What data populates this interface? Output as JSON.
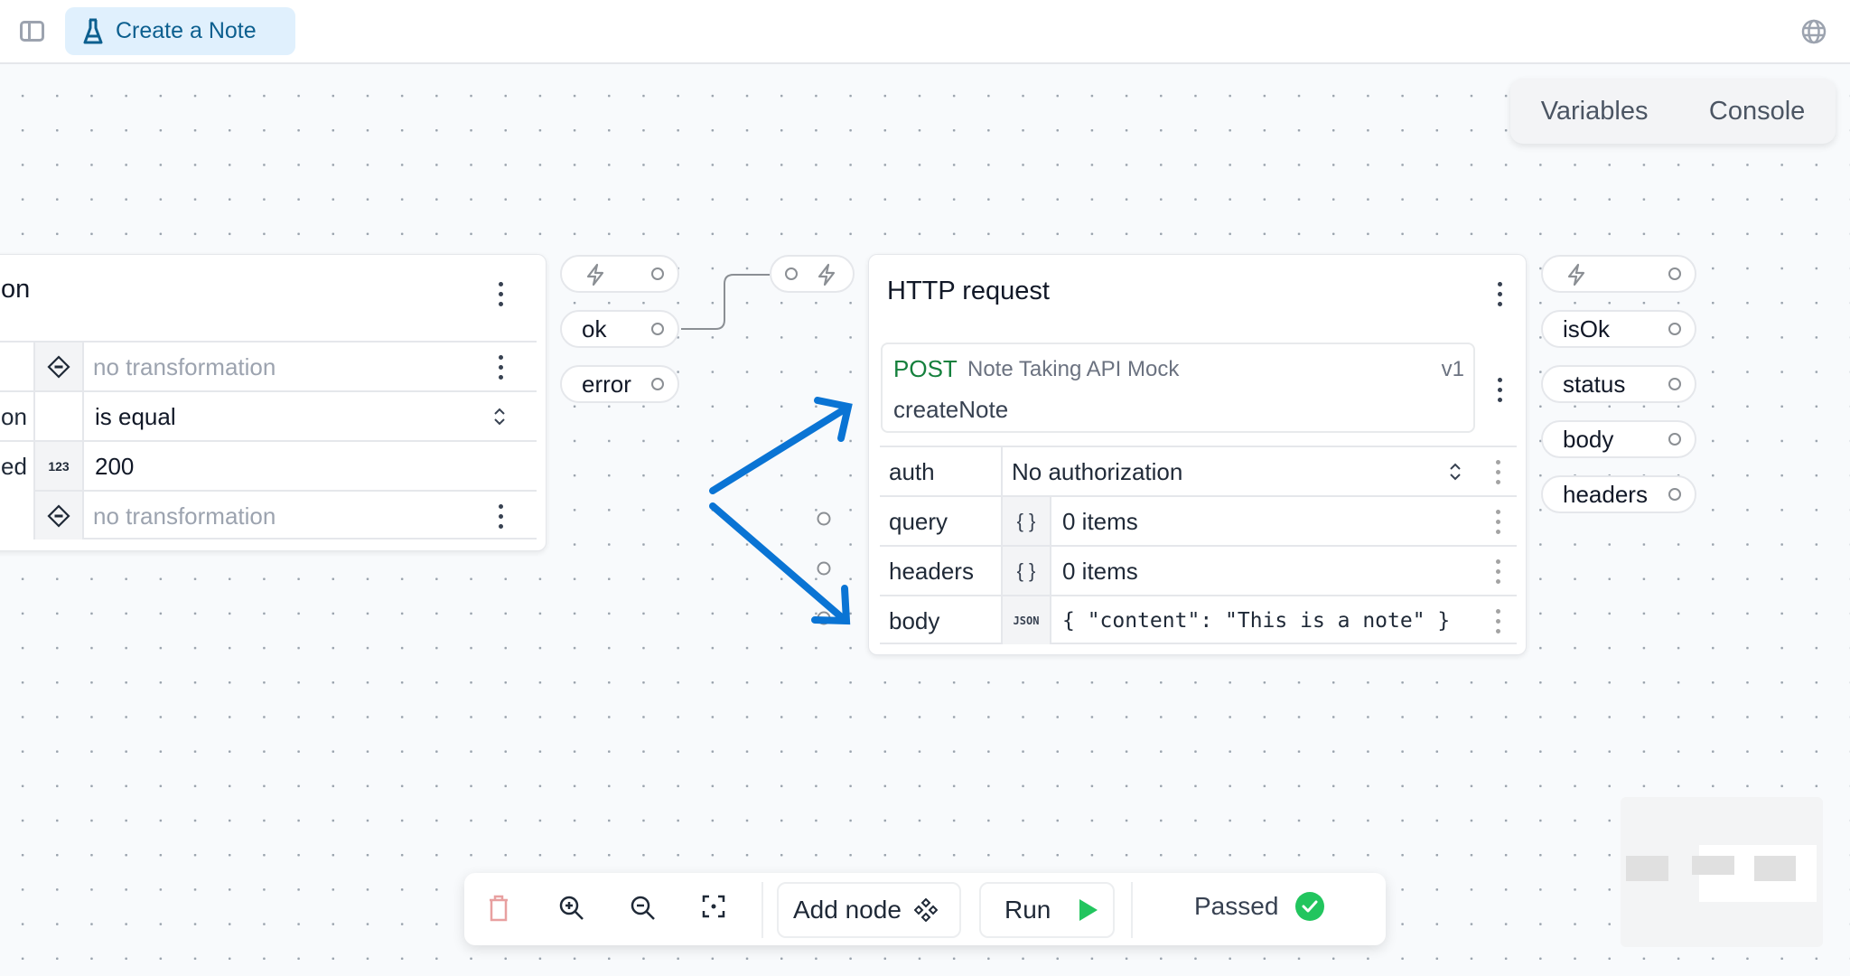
{
  "header": {
    "tab_title": "Create a Note",
    "tab_icon": "flask-icon",
    "sidebar_toggle_icon": "sidebar-icon",
    "language_icon": "globe-icon"
  },
  "panel_tabs": [
    "Variables",
    "Console"
  ],
  "left_node": {
    "title_fragment": "on",
    "rows": [
      {
        "label": "",
        "icon": "transform-icon",
        "value": "no transformation",
        "muted": true
      },
      {
        "label": "on",
        "icon": "",
        "value": "is equal",
        "muted": false
      },
      {
        "label": "ed",
        "icon": "number-icon",
        "icon_text": "123",
        "value": "200",
        "muted": false
      },
      {
        "label": "",
        "icon": "transform-icon",
        "value": "no transformation",
        "muted": true
      }
    ],
    "outputs": [
      "trigger",
      "ok",
      "error"
    ]
  },
  "http_node": {
    "title": "HTTP request",
    "operation": {
      "method": "POST",
      "api": "Note Taking API Mock",
      "version": "v1",
      "name": "createNote"
    },
    "params": [
      {
        "label": "auth",
        "value": "No authorization",
        "type": "select"
      },
      {
        "label": "query",
        "icon_text": "{ }",
        "value": "0 items"
      },
      {
        "label": "headers",
        "icon_text": "{ }",
        "value": "0 items"
      },
      {
        "label": "body",
        "icon_text": "JSON",
        "value": "{ \"content\": \"This is a note\" }"
      }
    ],
    "outputs": [
      "isOk",
      "status",
      "body",
      "headers"
    ]
  },
  "toolbar": {
    "add_node_label": "Add node",
    "run_label": "Run",
    "status_label": "Passed",
    "colors": {
      "run": "#22c55e",
      "passed": "#22c55e",
      "delete": "#e8a0a0"
    }
  },
  "annotation": {
    "color": "#0a74d4"
  }
}
